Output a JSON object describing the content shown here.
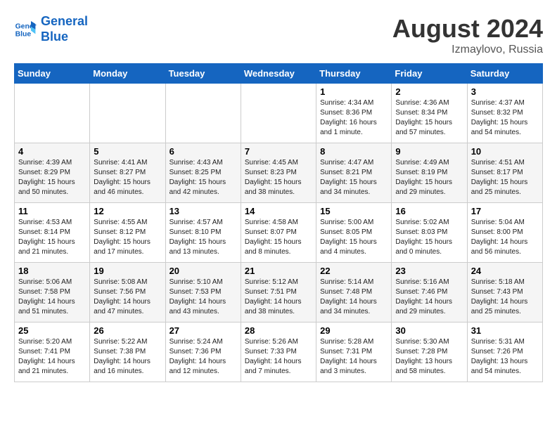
{
  "logo": {
    "line1": "General",
    "line2": "Blue"
  },
  "title": "August 2024",
  "subtitle": "Izmaylovo, Russia",
  "headers": [
    "Sunday",
    "Monday",
    "Tuesday",
    "Wednesday",
    "Thursday",
    "Friday",
    "Saturday"
  ],
  "weeks": [
    [
      {
        "day": "",
        "info": ""
      },
      {
        "day": "",
        "info": ""
      },
      {
        "day": "",
        "info": ""
      },
      {
        "day": "",
        "info": ""
      },
      {
        "day": "1",
        "info": "Sunrise: 4:34 AM\nSunset: 8:36 PM\nDaylight: 16 hours and 1 minute."
      },
      {
        "day": "2",
        "info": "Sunrise: 4:36 AM\nSunset: 8:34 PM\nDaylight: 15 hours and 57 minutes."
      },
      {
        "day": "3",
        "info": "Sunrise: 4:37 AM\nSunset: 8:32 PM\nDaylight: 15 hours and 54 minutes."
      }
    ],
    [
      {
        "day": "4",
        "info": "Sunrise: 4:39 AM\nSunset: 8:29 PM\nDaylight: 15 hours and 50 minutes."
      },
      {
        "day": "5",
        "info": "Sunrise: 4:41 AM\nSunset: 8:27 PM\nDaylight: 15 hours and 46 minutes."
      },
      {
        "day": "6",
        "info": "Sunrise: 4:43 AM\nSunset: 8:25 PM\nDaylight: 15 hours and 42 minutes."
      },
      {
        "day": "7",
        "info": "Sunrise: 4:45 AM\nSunset: 8:23 PM\nDaylight: 15 hours and 38 minutes."
      },
      {
        "day": "8",
        "info": "Sunrise: 4:47 AM\nSunset: 8:21 PM\nDaylight: 15 hours and 34 minutes."
      },
      {
        "day": "9",
        "info": "Sunrise: 4:49 AM\nSunset: 8:19 PM\nDaylight: 15 hours and 29 minutes."
      },
      {
        "day": "10",
        "info": "Sunrise: 4:51 AM\nSunset: 8:17 PM\nDaylight: 15 hours and 25 minutes."
      }
    ],
    [
      {
        "day": "11",
        "info": "Sunrise: 4:53 AM\nSunset: 8:14 PM\nDaylight: 15 hours and 21 minutes."
      },
      {
        "day": "12",
        "info": "Sunrise: 4:55 AM\nSunset: 8:12 PM\nDaylight: 15 hours and 17 minutes."
      },
      {
        "day": "13",
        "info": "Sunrise: 4:57 AM\nSunset: 8:10 PM\nDaylight: 15 hours and 13 minutes."
      },
      {
        "day": "14",
        "info": "Sunrise: 4:58 AM\nSunset: 8:07 PM\nDaylight: 15 hours and 8 minutes."
      },
      {
        "day": "15",
        "info": "Sunrise: 5:00 AM\nSunset: 8:05 PM\nDaylight: 15 hours and 4 minutes."
      },
      {
        "day": "16",
        "info": "Sunrise: 5:02 AM\nSunset: 8:03 PM\nDaylight: 15 hours and 0 minutes."
      },
      {
        "day": "17",
        "info": "Sunrise: 5:04 AM\nSunset: 8:00 PM\nDaylight: 14 hours and 56 minutes."
      }
    ],
    [
      {
        "day": "18",
        "info": "Sunrise: 5:06 AM\nSunset: 7:58 PM\nDaylight: 14 hours and 51 minutes."
      },
      {
        "day": "19",
        "info": "Sunrise: 5:08 AM\nSunset: 7:56 PM\nDaylight: 14 hours and 47 minutes."
      },
      {
        "day": "20",
        "info": "Sunrise: 5:10 AM\nSunset: 7:53 PM\nDaylight: 14 hours and 43 minutes."
      },
      {
        "day": "21",
        "info": "Sunrise: 5:12 AM\nSunset: 7:51 PM\nDaylight: 14 hours and 38 minutes."
      },
      {
        "day": "22",
        "info": "Sunrise: 5:14 AM\nSunset: 7:48 PM\nDaylight: 14 hours and 34 minutes."
      },
      {
        "day": "23",
        "info": "Sunrise: 5:16 AM\nSunset: 7:46 PM\nDaylight: 14 hours and 29 minutes."
      },
      {
        "day": "24",
        "info": "Sunrise: 5:18 AM\nSunset: 7:43 PM\nDaylight: 14 hours and 25 minutes."
      }
    ],
    [
      {
        "day": "25",
        "info": "Sunrise: 5:20 AM\nSunset: 7:41 PM\nDaylight: 14 hours and 21 minutes."
      },
      {
        "day": "26",
        "info": "Sunrise: 5:22 AM\nSunset: 7:38 PM\nDaylight: 14 hours and 16 minutes."
      },
      {
        "day": "27",
        "info": "Sunrise: 5:24 AM\nSunset: 7:36 PM\nDaylight: 14 hours and 12 minutes."
      },
      {
        "day": "28",
        "info": "Sunrise: 5:26 AM\nSunset: 7:33 PM\nDaylight: 14 hours and 7 minutes."
      },
      {
        "day": "29",
        "info": "Sunrise: 5:28 AM\nSunset: 7:31 PM\nDaylight: 14 hours and 3 minutes."
      },
      {
        "day": "30",
        "info": "Sunrise: 5:30 AM\nSunset: 7:28 PM\nDaylight: 13 hours and 58 minutes."
      },
      {
        "day": "31",
        "info": "Sunrise: 5:31 AM\nSunset: 7:26 PM\nDaylight: 13 hours and 54 minutes."
      }
    ]
  ]
}
